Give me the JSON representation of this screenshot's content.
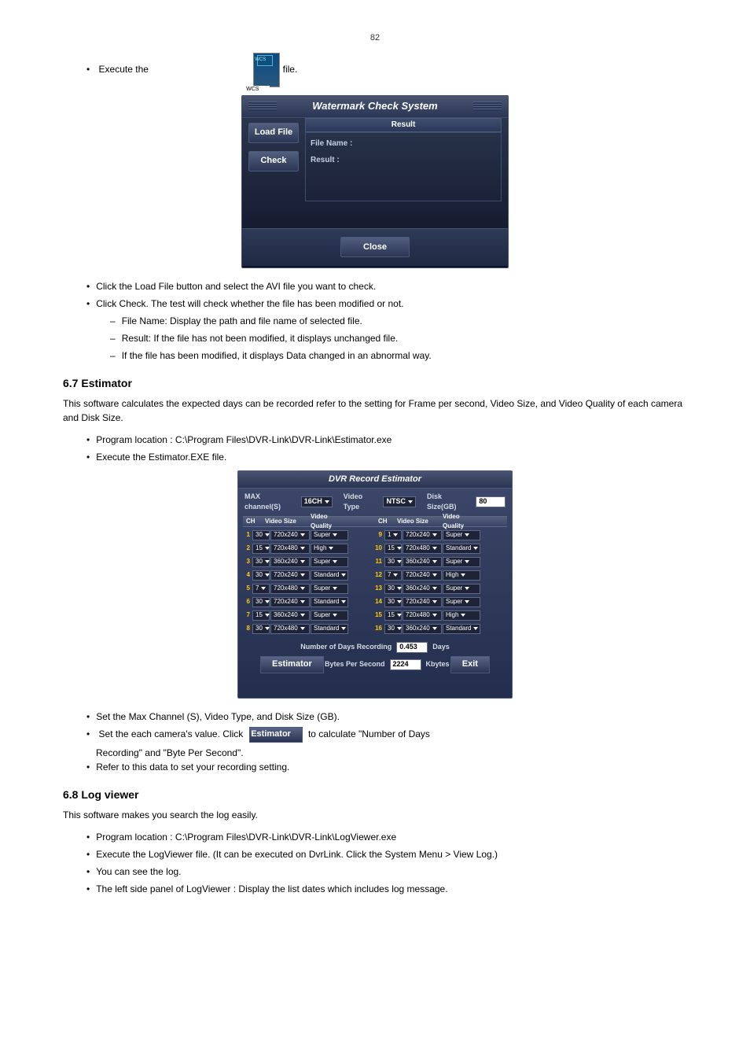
{
  "page_number": "82",
  "first_bullet_prefix": "Execute the ",
  "first_bullet_suffix": " file.",
  "wcs_icon_label": "WCS",
  "wcs": {
    "title": "Watermark Check System",
    "load_file_btn": "Load File",
    "check_btn": "Check",
    "close_btn": "Close",
    "result_hdr": "Result",
    "file_name_label": "File Name :",
    "result_label": "Result :"
  },
  "text": {
    "b_loadfile": "Click the Load File button and select the AVI file you want to check.",
    "b_clickcheck": "Click Check. The test will check whether the file has been modified or not.",
    "d_filename": "File Name: Display the path and file name of selected file.",
    "d_result_ok": "Result: If the file has not been modified, it displays unchanged file.",
    "d_result_bad": "If the file has been modified, it displays Data changed in an abnormal way.",
    "section_estimator_title": "6.7 Estimator",
    "section_estimator_body": "This software calculates the expected days can be recorded refer to the setting for Frame per second, Video Size, and Video Quality of each camera and Disk Size.",
    "est_location": "Program location : C:\\Program Files\\DVR-Link\\DVR-Link\\Estimator.exe",
    "est_execute": "Execute the Estimator.EXE file."
  },
  "estimator": {
    "title": "DVR Record Estimator",
    "max_channel_label": "MAX channel(S)",
    "max_channel_value": "16CH",
    "video_type_label": "Video Type",
    "video_type_value": "NTSC",
    "disk_size_label": "Disk Size(GB)",
    "disk_size_value": "80",
    "hdr_ch": "CH",
    "hdr_size": "Video Size",
    "hdr_q": "Video Quality",
    "left": [
      {
        "n": "1",
        "v": "30",
        "s": "720x240",
        "q": "Super"
      },
      {
        "n": "2",
        "v": "15",
        "s": "720x480",
        "q": "High"
      },
      {
        "n": "3",
        "v": "30",
        "s": "360x240",
        "q": "Super"
      },
      {
        "n": "4",
        "v": "30",
        "s": "720x240",
        "q": "Standard"
      },
      {
        "n": "5",
        "v": "7",
        "s": "720x480",
        "q": "Super"
      },
      {
        "n": "6",
        "v": "30",
        "s": "720x240",
        "q": "Standard"
      },
      {
        "n": "7",
        "v": "15",
        "s": "360x240",
        "q": "Super"
      },
      {
        "n": "8",
        "v": "30",
        "s": "720x480",
        "q": "Standard"
      }
    ],
    "right": [
      {
        "n": "9",
        "v": "1",
        "s": "720x240",
        "q": "Super"
      },
      {
        "n": "10",
        "v": "15",
        "s": "720x480",
        "q": "Standard"
      },
      {
        "n": "11",
        "v": "30",
        "s": "360x240",
        "q": "Super"
      },
      {
        "n": "12",
        "v": "7",
        "s": "720x240",
        "q": "High"
      },
      {
        "n": "13",
        "v": "30",
        "s": "360x240",
        "q": "Super"
      },
      {
        "n": "14",
        "v": "30",
        "s": "720x240",
        "q": "Super"
      },
      {
        "n": "15",
        "v": "15",
        "s": "720x480",
        "q": "High"
      },
      {
        "n": "16",
        "v": "30",
        "s": "360x240",
        "q": "Standard"
      }
    ],
    "days_label": "Number of Days Recording",
    "days_value": "0.453",
    "days_unit": "Days",
    "bps_label": "Bytes Per Second",
    "bps_value": "2224",
    "bps_unit": "Kbytes",
    "estimator_btn": "Estimator",
    "exit_btn": "Exit"
  },
  "text2": {
    "b_set_max": "Set the Max Channel (S), Video Type, and Disk Size (GB).",
    "b_set_each_prefix": "Set the each camera's value. Click ",
    "b_set_each_suffix": " to calculate \"Number of Days",
    "b_set_each_line2": "Recording\" and \"Byte Per Second\".",
    "b_refer": "Refer to this data to set your recording setting.",
    "section_log_title": "6.8 Log viewer",
    "section_log_body": "This software makes you search the log easily.",
    "b_log_loc": "Program location : C:\\Program Files\\DVR-Link\\DVR-Link\\LogViewer.exe",
    "b_execute_logviewer": "Execute the LogViewer file. (It can be executed on DvrLink. Click the System Menu > View Log.)",
    "b_see_log": "You can see the log.",
    "b_leftside": "The left side panel of LogViewer : Display the list dates which includes log message."
  }
}
